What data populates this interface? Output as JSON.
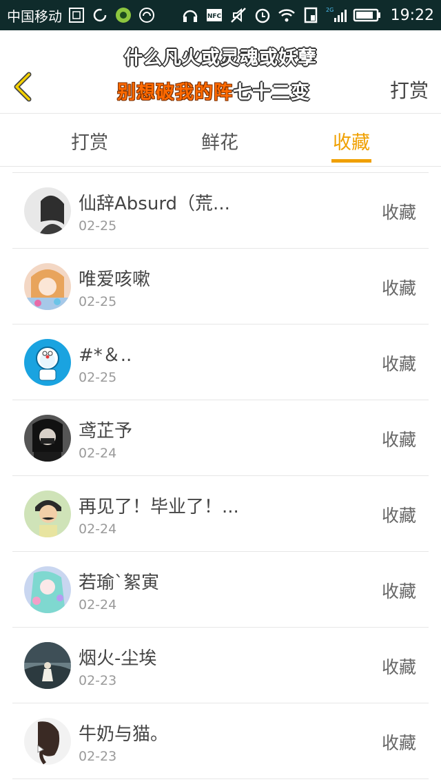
{
  "statusbar": {
    "carrier": "中国移动",
    "time": "19:22",
    "network": "2G",
    "icons": [
      "sim-card-icon",
      "sync-icon",
      "app-green-icon",
      "app-headset-icon",
      "headphones-icon",
      "nfc-icon",
      "mute-icon",
      "alarm-icon",
      "wifi-icon",
      "sim-status-icon",
      "signal-icon",
      "battery-icon"
    ]
  },
  "header": {
    "title_line1": "什么凡火或灵魂或妖孽",
    "title_line2_highlight": "别想破我的阵",
    "title_line2_rest": "七十二变",
    "right_action": "打赏",
    "back_icon": "chevron-left-icon"
  },
  "tabs": {
    "items": [
      {
        "label": "打赏"
      },
      {
        "label": "鲜花"
      },
      {
        "label": "收藏"
      }
    ],
    "active_index": 2,
    "active_color": "#f0a000"
  },
  "list": {
    "items": [
      {
        "name": "仙辞Absurd（荒...",
        "date": "02-25",
        "action": "收藏",
        "avatar": "avatar-gray-girl"
      },
      {
        "name": "唯爱咳嗽",
        "date": "02-25",
        "action": "收藏",
        "avatar": "avatar-anime-girl"
      },
      {
        "name": "#*＆..",
        "date": "02-25",
        "action": "收藏",
        "avatar": "avatar-doraemon"
      },
      {
        "name": "鸢芷予",
        "date": "02-24",
        "action": "收藏",
        "avatar": "avatar-masked"
      },
      {
        "name": "再见了！毕业了！...",
        "date": "02-24",
        "action": "收藏",
        "avatar": "avatar-mustache-kid"
      },
      {
        "name": "若瑜`絮寅",
        "date": "02-24",
        "action": "收藏",
        "avatar": "avatar-miku"
      },
      {
        "name": "烟火-尘埃",
        "date": "02-23",
        "action": "收藏",
        "avatar": "avatar-landscape"
      },
      {
        "name": "牛奶与猫。",
        "date": "02-23",
        "action": "收藏",
        "avatar": "avatar-ponytail"
      }
    ]
  }
}
